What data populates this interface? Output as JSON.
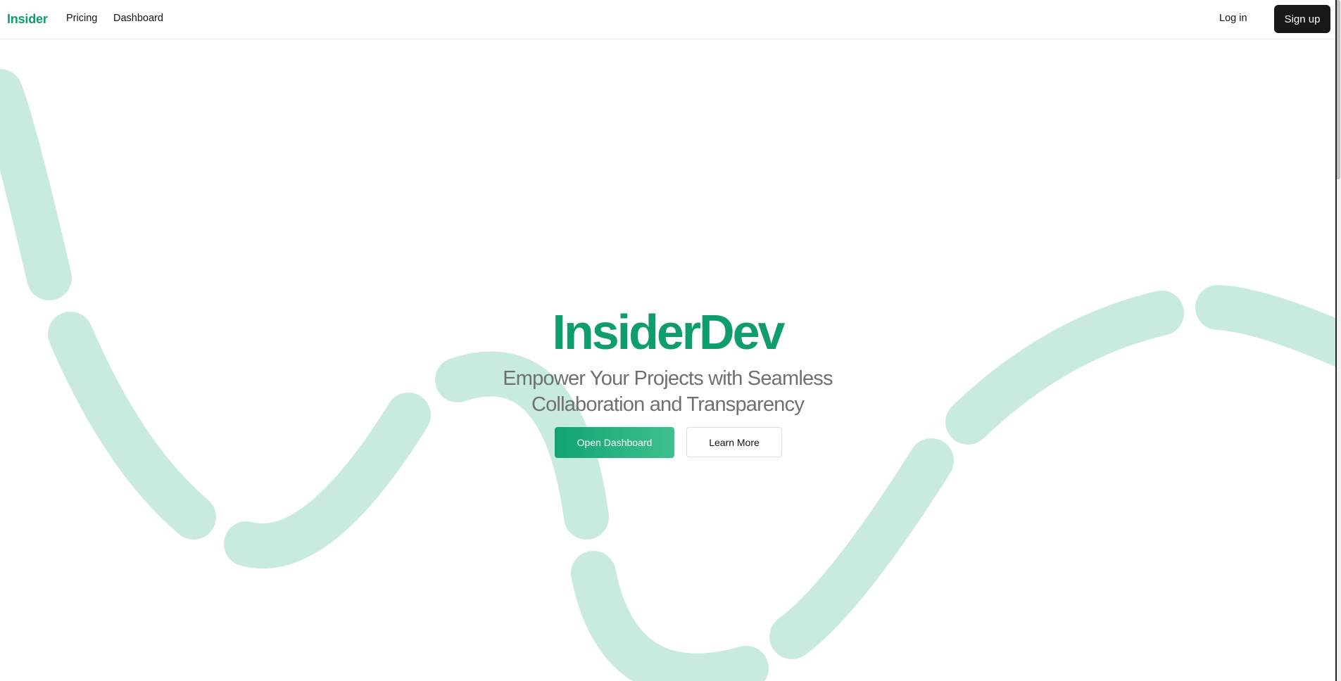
{
  "nav": {
    "brand": "Insider",
    "links": [
      "Pricing",
      "Dashboard"
    ],
    "login": "Log in",
    "signup": "Sign up"
  },
  "hero": {
    "title": "InsiderDev",
    "subtitle_line1": "Empower Your Projects with Seamless",
    "subtitle_line2": "Collaboration and Transparency",
    "primary_cta": "Open Dashboard",
    "secondary_cta": "Learn More"
  },
  "colors": {
    "brand": "#0f9d6c",
    "decor_wave": "#c8ebde",
    "signup_bg": "#18181b"
  }
}
